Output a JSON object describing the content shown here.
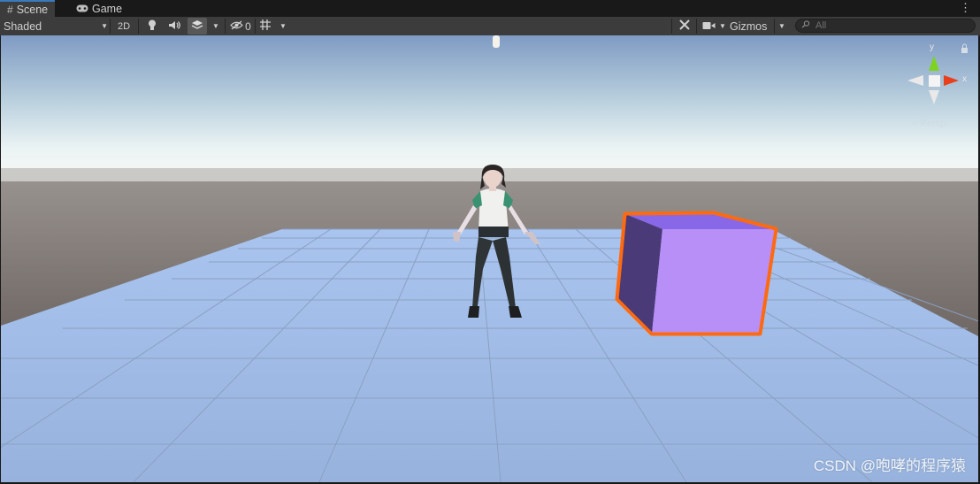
{
  "tabs": [
    {
      "label": "Scene",
      "icon": "grid-icon",
      "active": true
    },
    {
      "label": "Game",
      "icon": "gamepad-icon",
      "active": false
    }
  ],
  "toolbar": {
    "draw_mode": "Shaded",
    "mode_2d": "2D",
    "hidden_count": "0",
    "gizmos_label": "Gizmos",
    "search_placeholder": "All"
  },
  "gizmo": {
    "y_label": "y",
    "x_label": "x",
    "projection": "< Persp"
  },
  "watermark": "CSDN @咆哮的程序猿",
  "colors": {
    "cube_face": "#b88ff7",
    "cube_side": "#4a3a78",
    "selection_outline": "#ff6a10",
    "axis_x": "#e8401c",
    "axis_y": "#7ed321",
    "sky_top": "#7e9bc4",
    "ground_plane": "#9ab6e0",
    "horizon_ground": "#6b6461"
  }
}
